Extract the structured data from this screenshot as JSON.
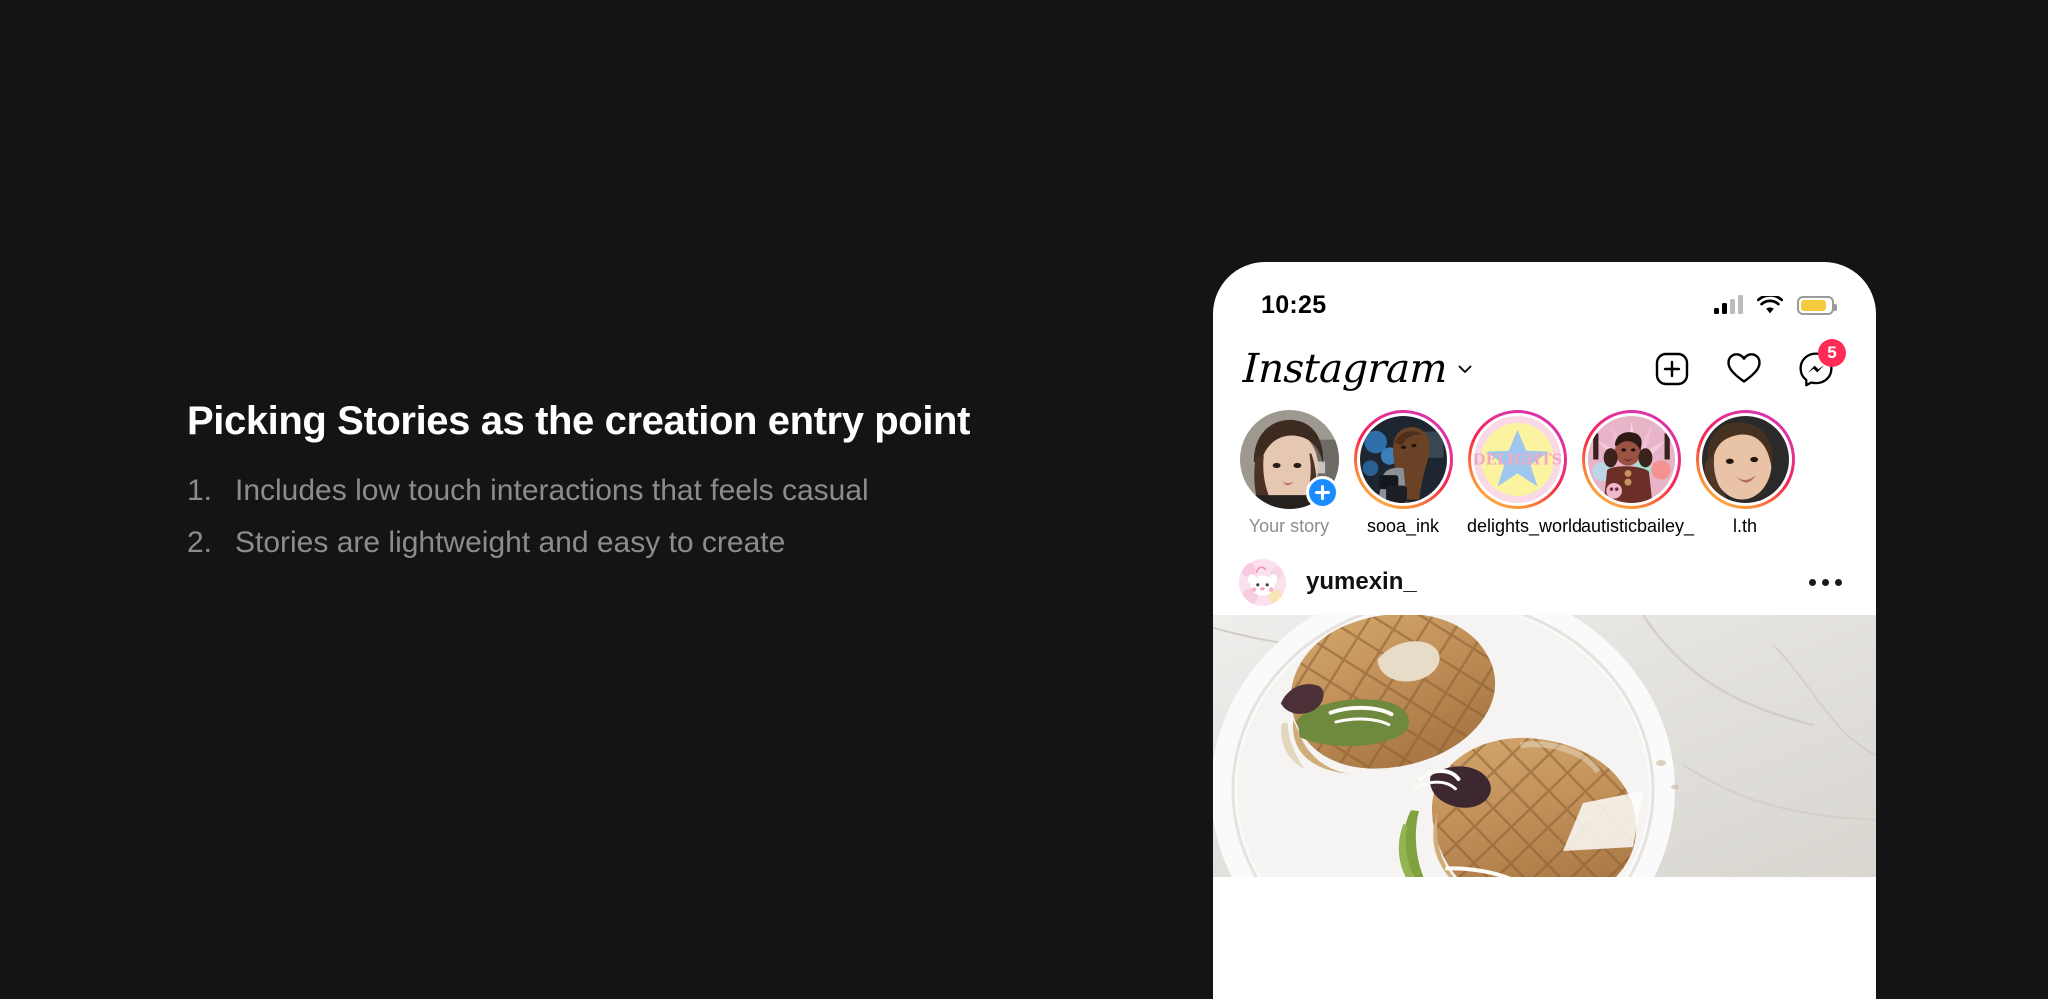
{
  "slide": {
    "heading": "Picking Stories as the creation entry point",
    "bullets": [
      {
        "num": "1.",
        "text": "Includes low touch interactions that feels casual"
      },
      {
        "num": "2.",
        "text": "Stories are lightweight and easy to create"
      }
    ],
    "background_color": "#141414",
    "heading_color": "#ffffff",
    "bullet_color": "#8c8c8c"
  },
  "phone": {
    "status_bar": {
      "time": "10:25",
      "signal_icon": "cellular-signal-icon",
      "wifi_icon": "wifi-icon",
      "battery_icon": "battery-icon",
      "battery_color": "#f5cb3d"
    },
    "header": {
      "brand": "Instagram",
      "chevron_icon": "chevron-down-icon",
      "create_icon": "plus-box-icon",
      "activity_icon": "heart-icon",
      "messenger_icon": "messenger-icon",
      "messenger_badge": "5",
      "badge_color": "#ff2d55"
    },
    "stories": [
      {
        "name": "Your story",
        "has_ring": false,
        "has_plus": true
      },
      {
        "name": "sooa_ink",
        "has_ring": true,
        "has_plus": false
      },
      {
        "name": "delights_world",
        "has_ring": true,
        "has_plus": false
      },
      {
        "name": "autisticbailey_",
        "has_ring": true,
        "has_plus": false
      },
      {
        "name": "l.th",
        "has_ring": true,
        "has_plus": false
      }
    ],
    "post": {
      "username": "yumexin_",
      "more_icon": "more-options-icon",
      "media_description": "waffle sandwiches on white plate on marble table"
    }
  }
}
